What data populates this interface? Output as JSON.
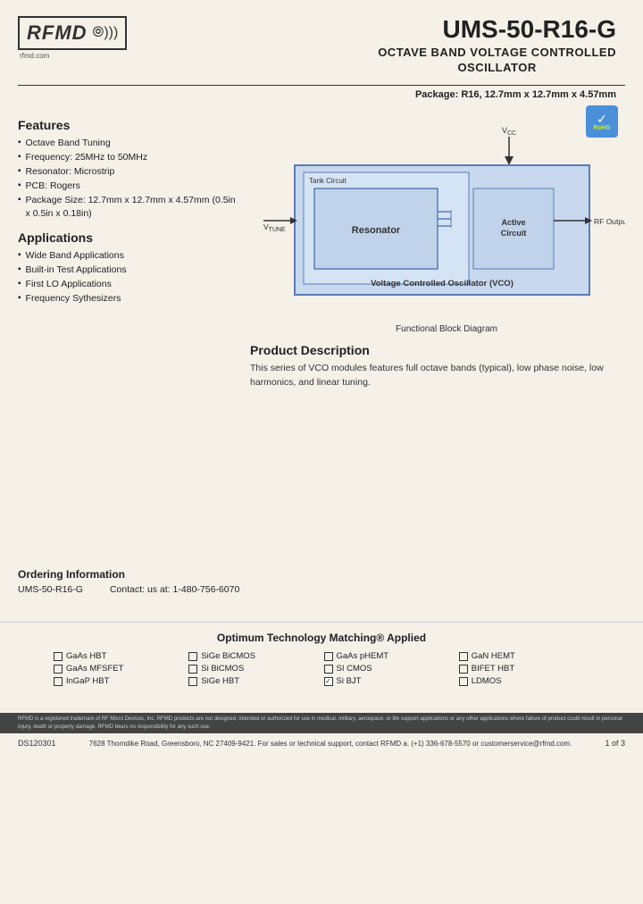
{
  "header": {
    "logo_text": "RFMD",
    "logo_waves": "◌))",
    "logo_url": "rfmd.com",
    "product_id": "UMS-50-R16-G",
    "subtitle_line1": "OCTAVE BAND VOLTAGE CONTROLLED",
    "subtitle_line2": "OSCILLATOR",
    "package_info": "Package: R16, 12.7mm x 12.7mm x 4.57mm",
    "rohs_label": "RoHS"
  },
  "features": {
    "title": "Features",
    "items": [
      "Octave Band Tuning",
      "Frequency: 25MHz to 50MHz",
      "Resonator: Microstrip",
      "PCB: Rogers",
      "Package Size: 12.7mm x 12.7mm x 4.57mm (0.5in x 0.5in x 0.18in)"
    ]
  },
  "applications": {
    "title": "Applications",
    "items": [
      "Wide Band Applications",
      "Built-in Test Applications",
      "First LO Applications",
      "Frequency Sythesizers"
    ]
  },
  "block_diagram": {
    "vcc_label": "V",
    "vcc_sub": "CC",
    "vtune_label": "V",
    "vtune_sub": "TUNE",
    "tank_circuit_label": "Tank Circuit",
    "resonator_label": "Resonator",
    "active_circuit_label": "Active Circuit",
    "vco_label": "Voltage Controlled Oscillator (VCO)",
    "rf_output_label": "RF Output",
    "caption": "Functional Block Diagram"
  },
  "product_description": {
    "title": "Product Description",
    "text": "This series of VCO modules features full octave bands (typical), low phase noise, low harmonics, and linear tuning."
  },
  "ordering": {
    "title": "Ordering Information",
    "part_number": "UMS-50-R16-G",
    "contact": "Contact: us at: 1-480-756-6070"
  },
  "technology": {
    "title": "Optimum Technology Matching® Applied",
    "items": [
      {
        "label": "GaAs HBT",
        "checked": false
      },
      {
        "label": "SiGe BiCMOS",
        "checked": false
      },
      {
        "label": "GaAs pHEMT",
        "checked": false
      },
      {
        "label": "GaN HEMT",
        "checked": false
      },
      {
        "label": "GaAs MFSFET",
        "checked": false
      },
      {
        "label": "Si BiCMOS",
        "checked": false
      },
      {
        "label": "SI CMOS",
        "checked": false
      },
      {
        "label": "BIFET HBT",
        "checked": false
      },
      {
        "label": "InGaP HBT",
        "checked": false
      },
      {
        "label": "SiGe HBT",
        "checked": false
      },
      {
        "label": "Si BJT",
        "checked": true
      },
      {
        "label": "LDMOS",
        "checked": false
      }
    ]
  },
  "footer": {
    "legal_text": "RFMD is a registered trademark of RF Micro Devices, Inc. RFMD products are not designed, intended or authorized for use in medical, military, aerospace, or life support applications or any other applications where failure of product could result in personal injury, death or property damage. RFMD bears no responsibility for any such use.",
    "address": "7628 Thorndike Road, Greensboro, NC 27409-9421. For sales or technical support, contact RFMD a. (+1) 336-678-5570 or customerservice@rfmd.com.",
    "doc_id": "DS120301",
    "page": "1 of 3"
  }
}
